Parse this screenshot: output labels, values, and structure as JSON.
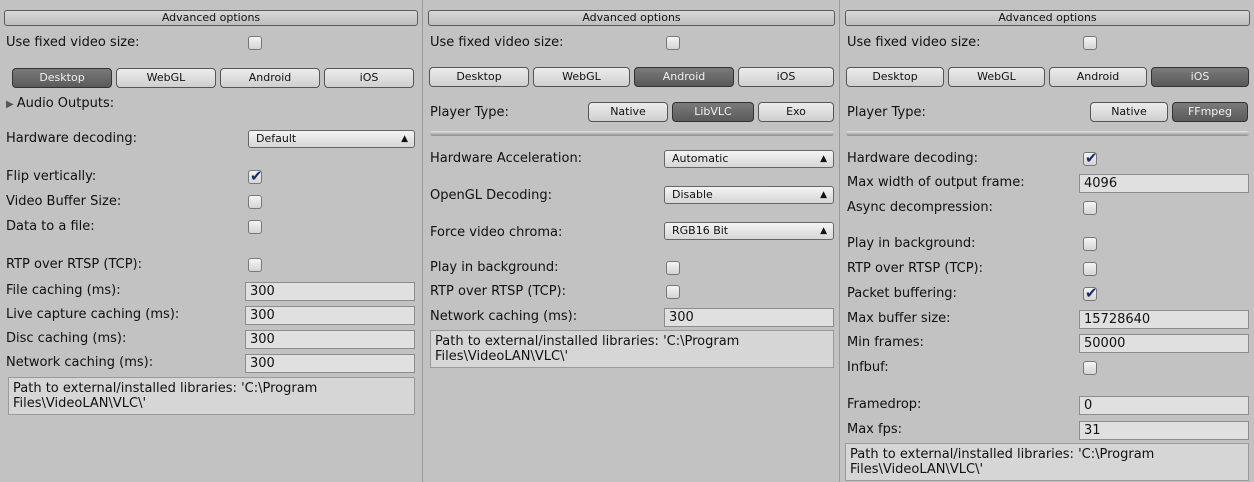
{
  "panels": [
    {
      "header": "Advanced options",
      "fixed_size_label": "Use fixed video size:",
      "tabs": [
        "Desktop",
        "WebGL",
        "Android",
        "iOS"
      ],
      "audio_outputs": "Audio Outputs:",
      "hw_decoding_label": "Hardware decoding:",
      "hw_decoding_value": "Default",
      "flip_label": "Flip vertically:",
      "buffer_label": "Video Buffer Size:",
      "file_label": "Data to a file:",
      "rtp_label": "RTP over RTSP (TCP):",
      "file_caching_label": "File caching (ms):",
      "file_caching_value": "300",
      "live_caching_label": "Live capture caching (ms):",
      "live_caching_value": "300",
      "disc_caching_label": "Disc caching (ms):",
      "disc_caching_value": "300",
      "net_caching_label": "Network caching (ms):",
      "net_caching_value": "300",
      "path_info": "Path to external/installed libraries: 'C:\\Program Files\\VideoLAN\\VLC\\'"
    },
    {
      "header": "Advanced options",
      "fixed_size_label": "Use fixed video size:",
      "tabs": [
        "Desktop",
        "WebGL",
        "Android",
        "iOS"
      ],
      "player_type_label": "Player Type:",
      "player_types": [
        "Native",
        "LibVLC",
        "Exo"
      ],
      "hw_accel_label": "Hardware Acceleration:",
      "hw_accel_value": "Automatic",
      "opengl_label": "OpenGL Decoding:",
      "opengl_value": "Disable",
      "chroma_label": "Force video chroma:",
      "chroma_value": "RGB16 Bit",
      "bg_label": "Play in background:",
      "rtp_label": "RTP over RTSP (TCP):",
      "net_caching_label": "Network caching (ms):",
      "net_caching_value": "300",
      "path_info": "Path to external/installed libraries: 'C:\\Program Files\\VideoLAN\\VLC\\'"
    },
    {
      "header": "Advanced options",
      "fixed_size_label": "Use fixed video size:",
      "tabs": [
        "Desktop",
        "WebGL",
        "Android",
        "iOS"
      ],
      "player_type_label": "Player Type:",
      "player_types": [
        "Native",
        "FFmpeg"
      ],
      "hw_decoding_label": "Hardware decoding:",
      "max_width_label": "Max width of output frame:",
      "max_width_value": "4096",
      "async_label": "Async decompression:",
      "bg_label": "Play in background:",
      "rtp_label": "RTP over RTSP (TCP):",
      "packet_label": "Packet buffering:",
      "max_buffer_label": "Max buffer size:",
      "max_buffer_value": "15728640",
      "min_frames_label": "Min frames:",
      "min_frames_value": "50000",
      "infbuf_label": "Infbuf:",
      "framedrop_label": "Framedrop:",
      "framedrop_value": "0",
      "max_fps_label": "Max fps:",
      "max_fps_value": "31",
      "path_info": "Path to external/installed libraries: 'C:\\Program Files\\VideoLAN\\VLC\\'"
    }
  ]
}
